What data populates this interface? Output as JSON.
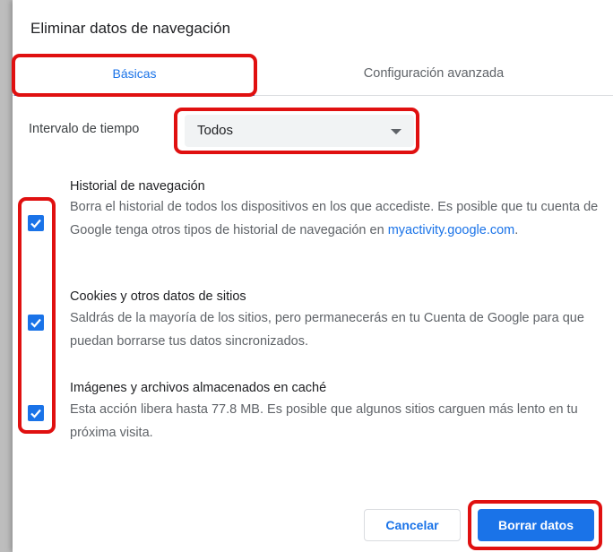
{
  "dialog": {
    "title": "Eliminar datos de navegación"
  },
  "tabs": [
    {
      "label": "Básicas",
      "active": true
    },
    {
      "label": "Configuración avanzada",
      "active": false
    }
  ],
  "time_range": {
    "label": "Intervalo de tiempo",
    "value": "Todos"
  },
  "items": [
    {
      "title": "Historial de navegación",
      "description": "Borra el historial de todos los dispositivos en los que accediste. Es posible que tu cuenta de Google tenga otros tipos de historial de navegación en",
      "link": "myactivity.google.com",
      "link_suffix": ".",
      "checked": true
    },
    {
      "title": "Cookies y otros datos de sitios",
      "description": "Saldrás de la mayoría de los sitios, pero permanecerás en tu Cuenta de Google para que puedan borrarse tus datos sincronizados.",
      "checked": true
    },
    {
      "title": "Imágenes y archivos almacenados en caché",
      "description": "Esta acción libera hasta 77.8 MB. Es posible que algunos sitios carguen más lento en tu próxima visita.",
      "checked": true
    }
  ],
  "buttons": {
    "cancel": "Cancelar",
    "clear": "Borrar datos"
  },
  "colors": {
    "accent": "#1a73e8",
    "highlight": "#e01010",
    "text": "#202124",
    "secondary": "#5f6368"
  }
}
